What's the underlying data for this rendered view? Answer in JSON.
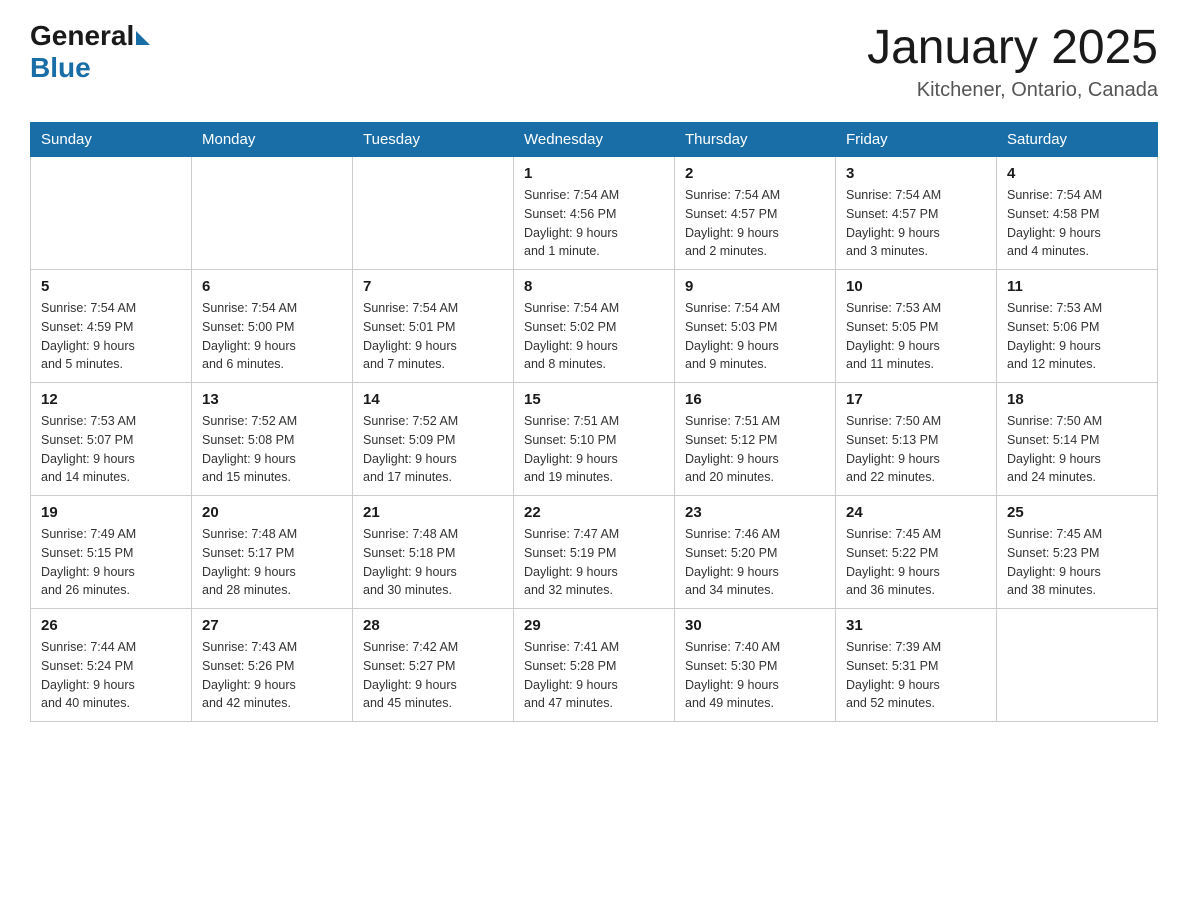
{
  "header": {
    "logo_general": "General",
    "logo_blue": "Blue",
    "month_title": "January 2025",
    "location": "Kitchener, Ontario, Canada"
  },
  "days_of_week": [
    "Sunday",
    "Monday",
    "Tuesday",
    "Wednesday",
    "Thursday",
    "Friday",
    "Saturday"
  ],
  "weeks": [
    [
      {
        "day": "",
        "info": ""
      },
      {
        "day": "",
        "info": ""
      },
      {
        "day": "",
        "info": ""
      },
      {
        "day": "1",
        "info": "Sunrise: 7:54 AM\nSunset: 4:56 PM\nDaylight: 9 hours\nand 1 minute."
      },
      {
        "day": "2",
        "info": "Sunrise: 7:54 AM\nSunset: 4:57 PM\nDaylight: 9 hours\nand 2 minutes."
      },
      {
        "day": "3",
        "info": "Sunrise: 7:54 AM\nSunset: 4:57 PM\nDaylight: 9 hours\nand 3 minutes."
      },
      {
        "day": "4",
        "info": "Sunrise: 7:54 AM\nSunset: 4:58 PM\nDaylight: 9 hours\nand 4 minutes."
      }
    ],
    [
      {
        "day": "5",
        "info": "Sunrise: 7:54 AM\nSunset: 4:59 PM\nDaylight: 9 hours\nand 5 minutes."
      },
      {
        "day": "6",
        "info": "Sunrise: 7:54 AM\nSunset: 5:00 PM\nDaylight: 9 hours\nand 6 minutes."
      },
      {
        "day": "7",
        "info": "Sunrise: 7:54 AM\nSunset: 5:01 PM\nDaylight: 9 hours\nand 7 minutes."
      },
      {
        "day": "8",
        "info": "Sunrise: 7:54 AM\nSunset: 5:02 PM\nDaylight: 9 hours\nand 8 minutes."
      },
      {
        "day": "9",
        "info": "Sunrise: 7:54 AM\nSunset: 5:03 PM\nDaylight: 9 hours\nand 9 minutes."
      },
      {
        "day": "10",
        "info": "Sunrise: 7:53 AM\nSunset: 5:05 PM\nDaylight: 9 hours\nand 11 minutes."
      },
      {
        "day": "11",
        "info": "Sunrise: 7:53 AM\nSunset: 5:06 PM\nDaylight: 9 hours\nand 12 minutes."
      }
    ],
    [
      {
        "day": "12",
        "info": "Sunrise: 7:53 AM\nSunset: 5:07 PM\nDaylight: 9 hours\nand 14 minutes."
      },
      {
        "day": "13",
        "info": "Sunrise: 7:52 AM\nSunset: 5:08 PM\nDaylight: 9 hours\nand 15 minutes."
      },
      {
        "day": "14",
        "info": "Sunrise: 7:52 AM\nSunset: 5:09 PM\nDaylight: 9 hours\nand 17 minutes."
      },
      {
        "day": "15",
        "info": "Sunrise: 7:51 AM\nSunset: 5:10 PM\nDaylight: 9 hours\nand 19 minutes."
      },
      {
        "day": "16",
        "info": "Sunrise: 7:51 AM\nSunset: 5:12 PM\nDaylight: 9 hours\nand 20 minutes."
      },
      {
        "day": "17",
        "info": "Sunrise: 7:50 AM\nSunset: 5:13 PM\nDaylight: 9 hours\nand 22 minutes."
      },
      {
        "day": "18",
        "info": "Sunrise: 7:50 AM\nSunset: 5:14 PM\nDaylight: 9 hours\nand 24 minutes."
      }
    ],
    [
      {
        "day": "19",
        "info": "Sunrise: 7:49 AM\nSunset: 5:15 PM\nDaylight: 9 hours\nand 26 minutes."
      },
      {
        "day": "20",
        "info": "Sunrise: 7:48 AM\nSunset: 5:17 PM\nDaylight: 9 hours\nand 28 minutes."
      },
      {
        "day": "21",
        "info": "Sunrise: 7:48 AM\nSunset: 5:18 PM\nDaylight: 9 hours\nand 30 minutes."
      },
      {
        "day": "22",
        "info": "Sunrise: 7:47 AM\nSunset: 5:19 PM\nDaylight: 9 hours\nand 32 minutes."
      },
      {
        "day": "23",
        "info": "Sunrise: 7:46 AM\nSunset: 5:20 PM\nDaylight: 9 hours\nand 34 minutes."
      },
      {
        "day": "24",
        "info": "Sunrise: 7:45 AM\nSunset: 5:22 PM\nDaylight: 9 hours\nand 36 minutes."
      },
      {
        "day": "25",
        "info": "Sunrise: 7:45 AM\nSunset: 5:23 PM\nDaylight: 9 hours\nand 38 minutes."
      }
    ],
    [
      {
        "day": "26",
        "info": "Sunrise: 7:44 AM\nSunset: 5:24 PM\nDaylight: 9 hours\nand 40 minutes."
      },
      {
        "day": "27",
        "info": "Sunrise: 7:43 AM\nSunset: 5:26 PM\nDaylight: 9 hours\nand 42 minutes."
      },
      {
        "day": "28",
        "info": "Sunrise: 7:42 AM\nSunset: 5:27 PM\nDaylight: 9 hours\nand 45 minutes."
      },
      {
        "day": "29",
        "info": "Sunrise: 7:41 AM\nSunset: 5:28 PM\nDaylight: 9 hours\nand 47 minutes."
      },
      {
        "day": "30",
        "info": "Sunrise: 7:40 AM\nSunset: 5:30 PM\nDaylight: 9 hours\nand 49 minutes."
      },
      {
        "day": "31",
        "info": "Sunrise: 7:39 AM\nSunset: 5:31 PM\nDaylight: 9 hours\nand 52 minutes."
      },
      {
        "day": "",
        "info": ""
      }
    ]
  ]
}
